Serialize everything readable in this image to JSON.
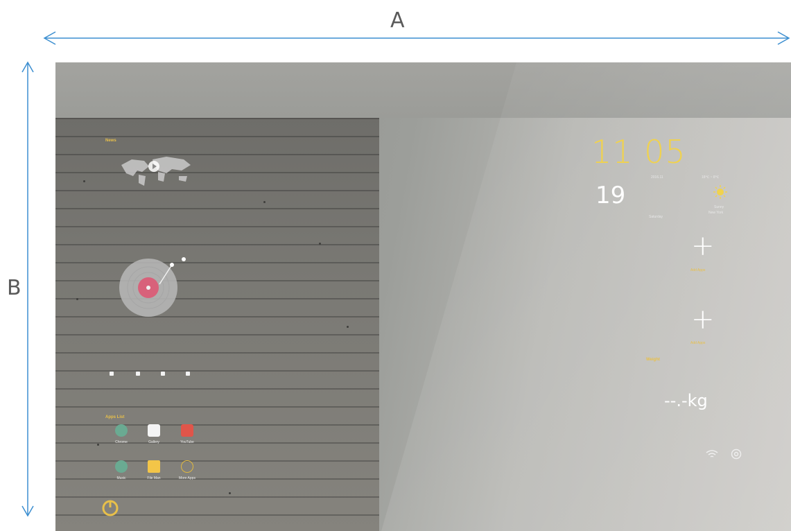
{
  "dimensions": {
    "width_label": "A",
    "height_label": "B"
  },
  "left_panel": {
    "news_label": "News",
    "music_controls": [
      "play-icon",
      "prev-icon",
      "next-icon",
      "list-icon"
    ],
    "apps_label": "Apps List",
    "apps": [
      {
        "label": "Chrome",
        "icon": "chrome-icon",
        "color": "#6aaa92"
      },
      {
        "label": "Gallery",
        "icon": "camera-icon",
        "color": "#f4f4f4"
      },
      {
        "label": "YouTube",
        "icon": "youtube-icon",
        "color": "#e0554a"
      },
      {
        "label": "Music",
        "icon": "music-icon",
        "color": "#6aaa92"
      },
      {
        "label": "File Man",
        "icon": "folder-icon",
        "color": "#f3c548"
      },
      {
        "label": "More Apps",
        "icon": "more-icon",
        "color": "#e2b93f"
      }
    ],
    "bottom_icon": "power-icon"
  },
  "right_panel": {
    "time": "11 05",
    "date": "2016.11",
    "day": "19",
    "weekday": "Saturday",
    "temperature": "18℃ ~ 8℃",
    "weather": "Sunny",
    "city": "New York",
    "add_labels": [
      "Add Apps",
      "Add Apps"
    ],
    "weight_label": "Weight",
    "weight_value": "--.-kg",
    "status_icons": [
      "wifi-icon",
      "settings-icon"
    ]
  },
  "colors": {
    "accent": "#f0d24e",
    "arrow": "#3b8ed0"
  }
}
